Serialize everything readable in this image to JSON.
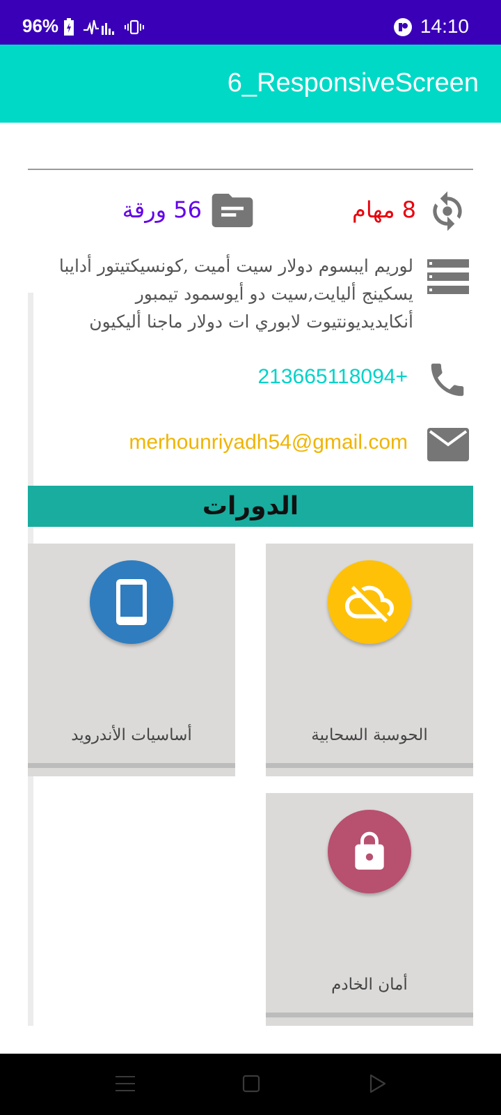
{
  "status_bar": {
    "battery": "96%",
    "time": "14:10"
  },
  "app_bar": {
    "title": "6_ResponsiveScreen"
  },
  "stats": {
    "tasks": "8 مهام",
    "papers": "56 ورقة"
  },
  "description": "لوريم ايبسوم دولار سيت أميت ,كونسيكتيتور أدايبا يسكينج أليايت,سيت دو أيوسمود تيمبور أنكايديديونتيوت لابوري ات دولار ماجنا أليكيون",
  "contact": {
    "phone": "213665118094+",
    "email": "merhounriyadh54@gmail.com"
  },
  "courses": {
    "title": "الدورات",
    "items": [
      {
        "label": "الحوسبة السحابية",
        "icon": "cloud-off-icon",
        "color": "#ffc107"
      },
      {
        "label": "أساسيات الأندرويد",
        "icon": "smartphone-icon",
        "color": "#2f7dbf"
      },
      {
        "label": "أمان الخادم",
        "icon": "lock-icon",
        "color": "#b85070"
      }
    ]
  },
  "colors": {
    "status_bar": "#3a00b8",
    "app_bar": "#00d9c6",
    "courses_header": "#18ad9f",
    "tasks": "#e8000c",
    "papers": "#6200ea",
    "phone": "#00d2c8",
    "email": "#f0b400"
  }
}
